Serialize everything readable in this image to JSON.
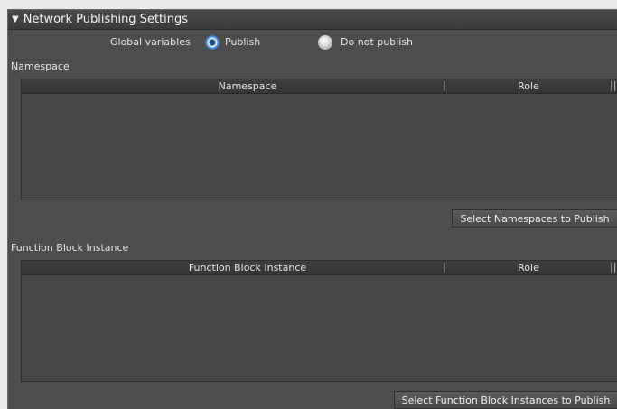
{
  "header": {
    "title": "Network Publishing Settings",
    "toggle_icon": "triangle-down-icon"
  },
  "global_variables": {
    "label": "Global variables",
    "options": [
      {
        "label": "Publish",
        "checked": true
      },
      {
        "label": "Do not publish",
        "checked": false
      }
    ]
  },
  "namespace_section": {
    "label": "Namespace",
    "columns": [
      "Namespace",
      "Role"
    ],
    "rows": [],
    "button": "Select Namespaces to Publish"
  },
  "fb_section": {
    "label": "Function Block Instance",
    "columns": [
      "Function Block Instance",
      "Role"
    ],
    "rows": [],
    "button": "Select Function Block Instances to Publish"
  }
}
